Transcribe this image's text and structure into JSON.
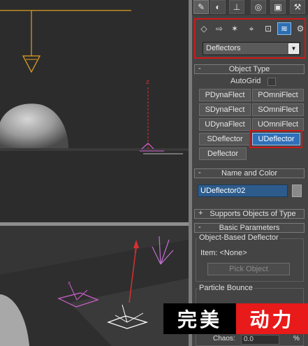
{
  "tabs": [
    {
      "icon": "create-icon"
    },
    {
      "icon": "modify-icon"
    },
    {
      "icon": "hierarchy-icon"
    },
    {
      "icon": "motion-icon"
    },
    {
      "icon": "display-icon"
    },
    {
      "icon": "utilities-icon"
    }
  ],
  "toolbox": {
    "categories": [
      {
        "icon": "geometry-icon"
      },
      {
        "icon": "shapes-icon"
      },
      {
        "icon": "lights-icon"
      },
      {
        "icon": "cameras-icon"
      },
      {
        "icon": "helpers-icon"
      },
      {
        "icon": "space-warps-icon"
      },
      {
        "icon": "systems-icon"
      }
    ],
    "selected_category": "space-warps-icon",
    "dropdown_value": "Deflectors"
  },
  "object_type": {
    "header_sign": "-",
    "title": "Object Type",
    "autogrid_label": "AutoGrid",
    "buttons": [
      "PDynaFlect",
      "POmniFlect",
      "SDynaFlect",
      "SOmniFlect",
      "UDynaFlect",
      "UOmniFlect",
      "SDeflector",
      "UDeflector",
      "Deflector"
    ],
    "active_button": "UDeflector"
  },
  "name_and_color": {
    "header_sign": "-",
    "title": "Name and Color",
    "object_name": "UDeflector02"
  },
  "supports": {
    "header_sign": "+",
    "title": "Supports Objects of Type"
  },
  "basic_parameters": {
    "header_sign": "-",
    "title": "Basic Parameters",
    "group_title": "Object-Based Deflector",
    "item_label": "Item: <None>",
    "pick_button": "Pick Object",
    "particle_bounce_title": "Particle Bounce",
    "chaos_label": "Chaos:",
    "chaos_value": "0.0",
    "chaos_unit": "%"
  },
  "watermark": {
    "left_text": "完美",
    "right_text": "动力"
  },
  "viewport_labels": {
    "axis_z_top": "z",
    "axis_z_bottom": "z",
    "axis_x": "x"
  },
  "colors": {
    "selection_accent": "#2f70b8",
    "highlight_red": "#d01818",
    "orange_wire": "#e0a020",
    "pink_gizmo": "#d060d0",
    "red_axis": "#d83030"
  }
}
